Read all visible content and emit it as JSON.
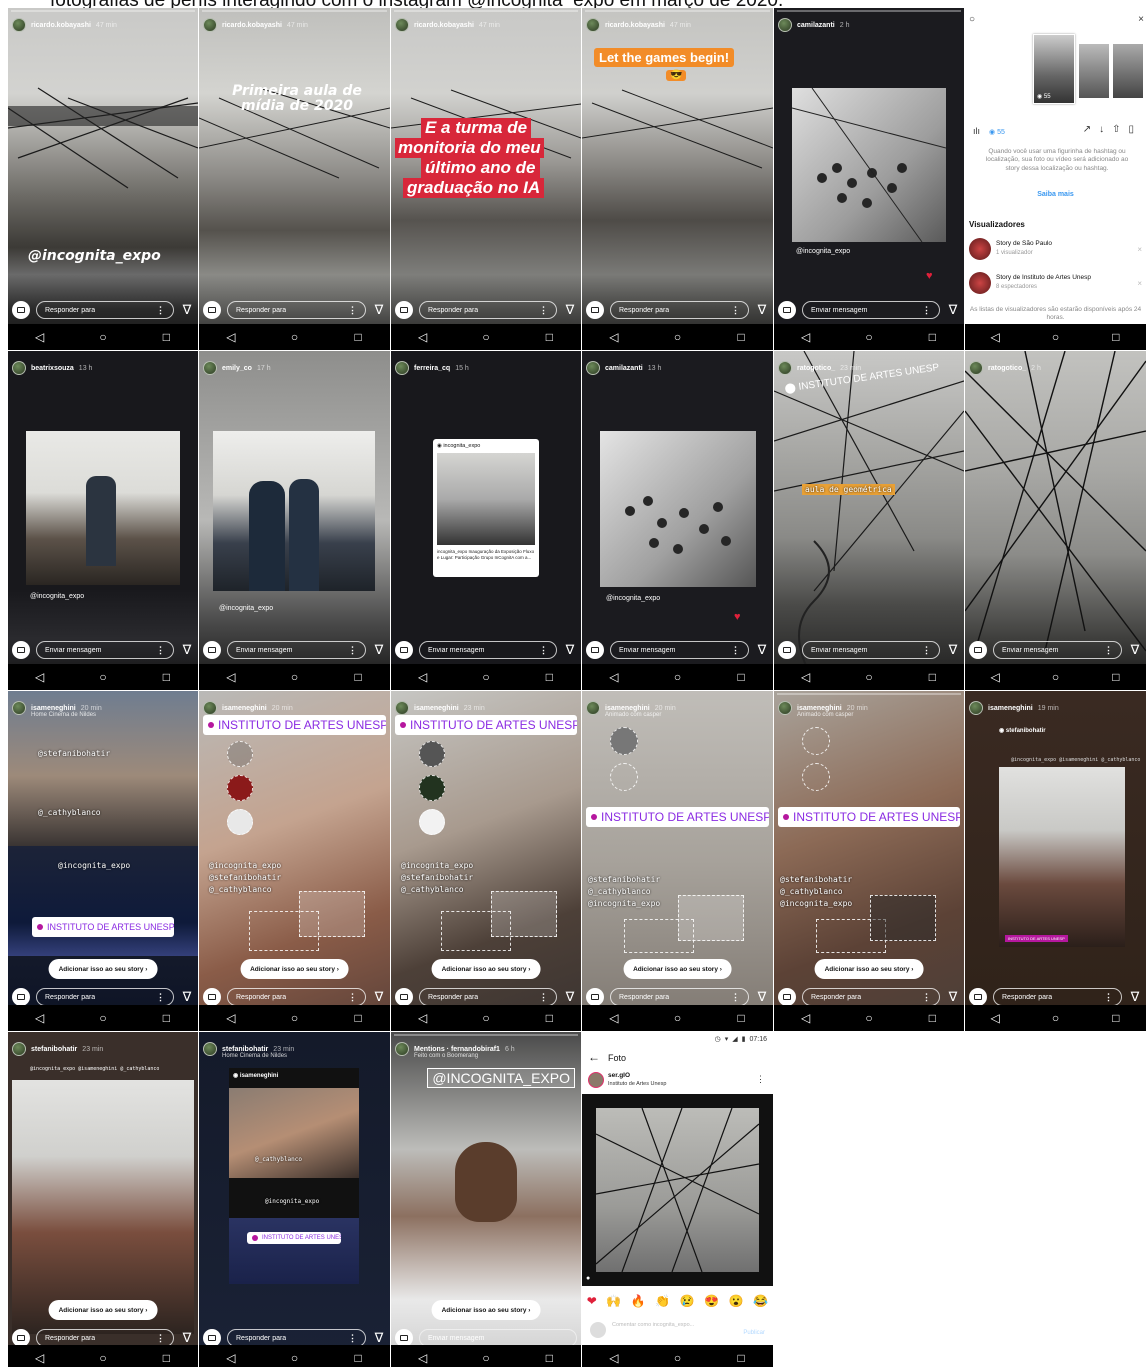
{
  "caption": "fotografias de perfis interagindo com o instagram @incognita_expo em março de 2020.",
  "common": {
    "reply_placeholder": "Responder para",
    "message_placeholder": "Enviar mensagem",
    "add_to_story": "Adicionar isso ao seu story",
    "nav_back": "◁",
    "nav_home": "○",
    "nav_recent": "□",
    "location_sticker": "INSTITUTO DE ARTES UNESP",
    "mention_incognita": "@incognita_expo"
  },
  "panels": [
    {
      "user": "ricardo.kobayashi",
      "time": "47 min",
      "overlay": "@incognita_expo",
      "input": "reply"
    },
    {
      "user": "ricardo.kobayashi",
      "time": "47 min",
      "overlay": "Primeira aula de mídia de 2020",
      "input": "reply"
    },
    {
      "user": "ricardo.kobayashi",
      "time": "47 min",
      "overlay_lines": [
        "E a turma de",
        "monitoria do meu",
        "último ano de",
        "graduação no IA"
      ],
      "input": "reply"
    },
    {
      "user": "ricardo.kobayashi",
      "time": "47 min",
      "overlay": "Let the games begin!",
      "overlay_emoji": "😎",
      "input": "reply"
    },
    {
      "user": "camilazanti",
      "time": "2 h",
      "mention": "@incognita_expo",
      "input": "message"
    },
    {
      "views": "55",
      "hint": "Quando você usar uma figurinha de hashtag ou localização, sua foto ou vídeo será adicionado ao story dessa localização ou hashtag.",
      "learn_more": "Saiba mais",
      "viewers_title": "Visualizadores",
      "viewers": [
        {
          "name": "Story de São Paulo",
          "count": "1 visualizador"
        },
        {
          "name": "Story de Instituto de Artes Unesp",
          "count": "8 espectadores"
        }
      ],
      "footer": "As listas de visualizadores são estarão disponíveis após 24 horas."
    },
    {
      "user": "beatrixsouza",
      "time": "13 h",
      "mention": "@incognita_expo",
      "input": "message"
    },
    {
      "user": "emily_co",
      "time": "17 h",
      "mention": "@incognita_expo",
      "input": "message"
    },
    {
      "user": "ferreira_cq",
      "time": "15 h",
      "post_user": "incognita_expo",
      "post_caption": "incognita_expo Inauguração da Exposição Fluxo e Lugar: Participação Grupo InCognitA com a...",
      "input": "message"
    },
    {
      "user": "camilazanti",
      "time": "13 h",
      "mention": "@incognita_expo",
      "input": "message"
    },
    {
      "user": "ratogotico_",
      "time": "23 min",
      "location": "INSTITUTO DE ARTES UNESP",
      "mono": "aula de geométrica",
      "input": "message"
    },
    {
      "user": "ratogotico_",
      "time": "2 h",
      "input": "message"
    },
    {
      "user": "isameneghini",
      "time": "20 min",
      "sub": "Home Cinema de Nildes",
      "mentions": [
        "@stefanibohatir",
        "@_cathyblanco",
        "@incognita_expo"
      ],
      "input": "reply"
    },
    {
      "user": "isameneghini",
      "time": "20 min",
      "mentions": [
        "@incognita_expo",
        "@stefanibohatir",
        "@_cathyblanco"
      ],
      "input": "reply"
    },
    {
      "user": "isameneghini",
      "time": "23 min",
      "mentions": [
        "@incognita_expo",
        "@stefanibohatir",
        "@_cathyblanco"
      ],
      "input": "reply"
    },
    {
      "user": "isameneghini",
      "time": "20 min",
      "sub": "Animado com casper",
      "mentions": [
        "@stefanibohatir",
        "@_cathyblanco",
        "@incognita_expo"
      ],
      "input": "reply"
    },
    {
      "user": "isameneghini",
      "time": "20 min",
      "sub": "Animado com casper",
      "mentions": [
        "@stefanibohatir",
        "@_cathyblanco",
        "@incognita_expo"
      ],
      "input": "reply"
    },
    {
      "user": "isameneghini",
      "time": "19 min",
      "inner_user": "stefanibohatir",
      "inner_mentions": "@incognita_expo @isameneghini @_cathyblanco",
      "inner_loc": "INSTITUTO DE ARTES UNESP",
      "input": "reply"
    },
    {
      "user": "stefanibohatir",
      "time": "23 min",
      "mentions_line": "@incognita_expo @isameneghini @_cathyblanco",
      "input": "reply"
    },
    {
      "user": "stefanibohatir",
      "time": "23 min",
      "sub": "Home Cinema de Nildes",
      "inner_user": "isameneghini",
      "mention1": "@_cathyblanco",
      "mention2": "@incognita_expo",
      "input": "reply"
    },
    {
      "user": "Mentions · fernandobiraf1",
      "time": "6 h",
      "sub": "Feito com o Boomerang",
      "sticker": "@INCOGNITA_EXPO",
      "input": "message"
    },
    {
      "status_time": "07:16",
      "title": "Foto",
      "post_user": "ser.gIO",
      "post_location": "Instituto de Artes Unesp",
      "comment_placeholder": "Comentar como incognita_expo...",
      "publish": "Publicar"
    }
  ]
}
